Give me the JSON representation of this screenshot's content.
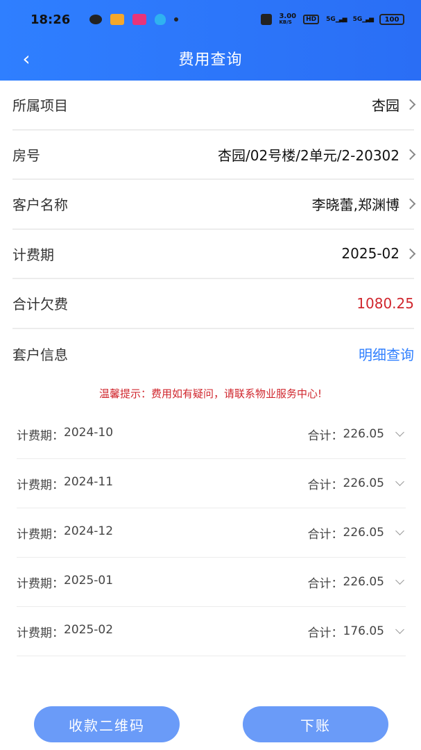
{
  "status_bar": {
    "time": "18:26",
    "network_speed": "3.00",
    "network_unit": "KB/S",
    "hd_label": "HD",
    "signal_1": "5G",
    "signal_2": "5G",
    "battery": "100"
  },
  "header": {
    "title": "费用查询"
  },
  "form": {
    "project": {
      "label": "所属项目",
      "value": "杏园"
    },
    "room": {
      "label": "房号",
      "value": "杏园/02号楼/2单元/2-20302"
    },
    "customer": {
      "label": "客户名称",
      "value": "李晓蕾,郑渊博"
    },
    "billing_period": {
      "label": "计费期",
      "value": "2025-02"
    },
    "total_arrears": {
      "label": "合计欠费",
      "value": "1080.25"
    },
    "household": {
      "label": "套户信息",
      "link": "明细查询"
    }
  },
  "tip": "温馨提示：费用如有疑问，请联系物业服务中心!",
  "periods": [
    {
      "label": "计费期：",
      "period": "2024-10",
      "total_label": "合计：",
      "total": "226.05"
    },
    {
      "label": "计费期：",
      "period": "2024-11",
      "total_label": "合计：",
      "total": "226.05"
    },
    {
      "label": "计费期：",
      "period": "2024-12",
      "total_label": "合计：",
      "total": "226.05"
    },
    {
      "label": "计费期：",
      "period": "2025-01",
      "total_label": "合计：",
      "total": "226.05"
    },
    {
      "label": "计费期：",
      "period": "2025-02",
      "total_label": "合计：",
      "total": "176.05"
    }
  ],
  "buttons": {
    "qr_code": "收款二维码",
    "write_off": "下账"
  },
  "colors": {
    "primary": "#2f7fff",
    "button": "#6a9bf8",
    "alert": "#d0262d"
  }
}
